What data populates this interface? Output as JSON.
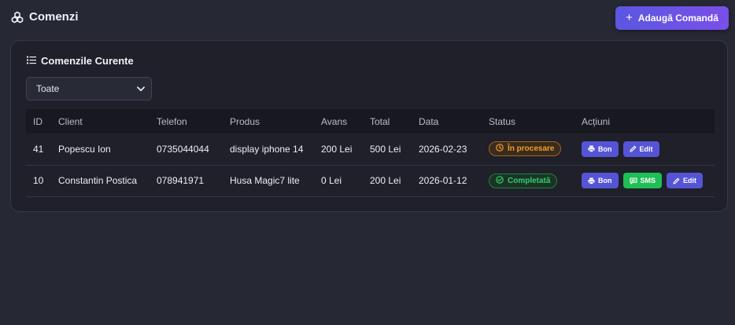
{
  "header": {
    "title": "Comenzi",
    "logo_icon": "cubes-icon",
    "add_button_label": "Adaugă Comandă"
  },
  "card": {
    "title": "Comenzile Curente",
    "filter": {
      "selected": "Toate"
    }
  },
  "table": {
    "columns": [
      "ID",
      "Client",
      "Telefon",
      "Produs",
      "Avans",
      "Total",
      "Data",
      "Status",
      "Acțiuni"
    ],
    "rows": [
      {
        "id": "41",
        "client": "Popescu Ion",
        "phone": "0735044044",
        "product": "display iphone 14",
        "advance": "200 Lei",
        "total": "500 Lei",
        "date": "2026-02-23",
        "status": "În procesare",
        "actions": [
          "Bon",
          "Edit"
        ]
      },
      {
        "id": "10",
        "client": "Constantin Postica",
        "phone": "078941971",
        "product": "Husa Magic7 lite",
        "advance": "0 Lei",
        "total": "200 Lei",
        "date": "2026-01-12",
        "status": "Completată",
        "actions": [
          "Bon",
          "SMS",
          "Edit"
        ]
      }
    ]
  },
  "colors": {
    "background": "#262834",
    "card": "#1f2029",
    "accent": "#5554d6",
    "processing": "#f39c2a",
    "completed": "#2fd06a",
    "sms": "#1fbf55"
  }
}
